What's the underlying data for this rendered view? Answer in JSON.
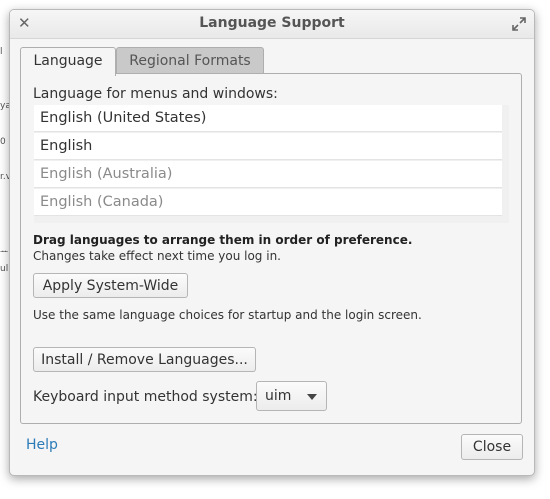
{
  "window": {
    "title": "Language Support"
  },
  "tabs": [
    {
      "label": "Language"
    },
    {
      "label": "Regional Formats"
    }
  ],
  "language_section": {
    "heading": "Language for menus and windows:",
    "languages": [
      {
        "label": "English (United States)"
      },
      {
        "label": "English"
      },
      {
        "label": "English (Australia)"
      },
      {
        "label": "English (Canada)"
      }
    ],
    "drag_hint": "Drag languages to arrange them in order of preference.",
    "effect_note": "Changes take effect next time you log in.",
    "apply_button": "Apply System-Wide",
    "apply_note": "Use the same language choices for startup and the login screen.",
    "install_button": "Install / Remove Languages...",
    "keyboard_label": "Keyboard input method system:",
    "keyboard_value": "uim"
  },
  "footer": {
    "help_label": "Help",
    "close_label": "Close"
  },
  "background": {
    "fragments": [
      "l",
      "ya",
      "0",
      "r.v",
      "ᅭ",
      "uli"
    ]
  }
}
